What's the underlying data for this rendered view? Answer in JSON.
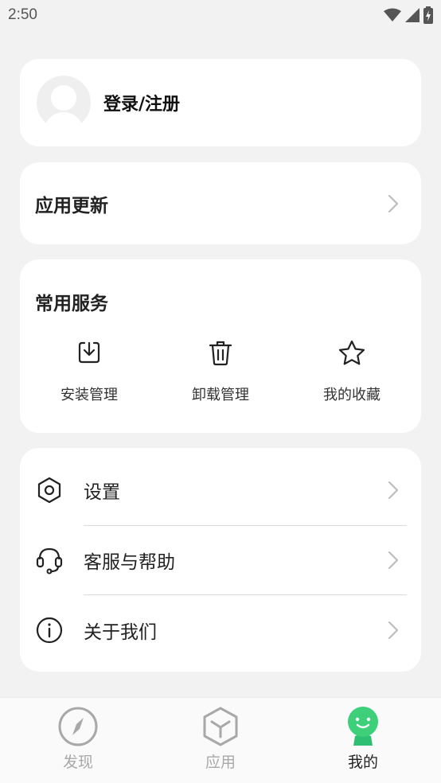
{
  "status_bar": {
    "time": "2:50",
    "icons": [
      "wifi-icon",
      "signal-icon",
      "battery-charging-icon"
    ]
  },
  "profile": {
    "login_label": "登录/注册",
    "avatar_icon": "default-avatar-icon"
  },
  "update": {
    "title": "应用更新",
    "chevron_icon": "chevron-right-icon"
  },
  "services": {
    "title": "常用服务",
    "items": [
      {
        "label": "安装管理",
        "icon": "download-icon"
      },
      {
        "label": "卸载管理",
        "icon": "trash-icon"
      },
      {
        "label": "我的收藏",
        "icon": "star-icon"
      }
    ]
  },
  "menu": {
    "items": [
      {
        "label": "设置",
        "icon": "settings-icon"
      },
      {
        "label": "客服与帮助",
        "icon": "headset-icon"
      },
      {
        "label": "关于我们",
        "icon": "info-icon"
      }
    ]
  },
  "tab_bar": {
    "tabs": [
      {
        "label": "发现",
        "icon": "compass-icon",
        "active": false
      },
      {
        "label": "应用",
        "icon": "cube-icon",
        "active": false
      },
      {
        "label": "我的",
        "icon": "mascot-icon",
        "active": true
      }
    ]
  },
  "colors": {
    "background": "#f2f2f2",
    "card": "#ffffff",
    "accent_green": "#3ecf7a",
    "inactive": "#a8a8a8"
  }
}
